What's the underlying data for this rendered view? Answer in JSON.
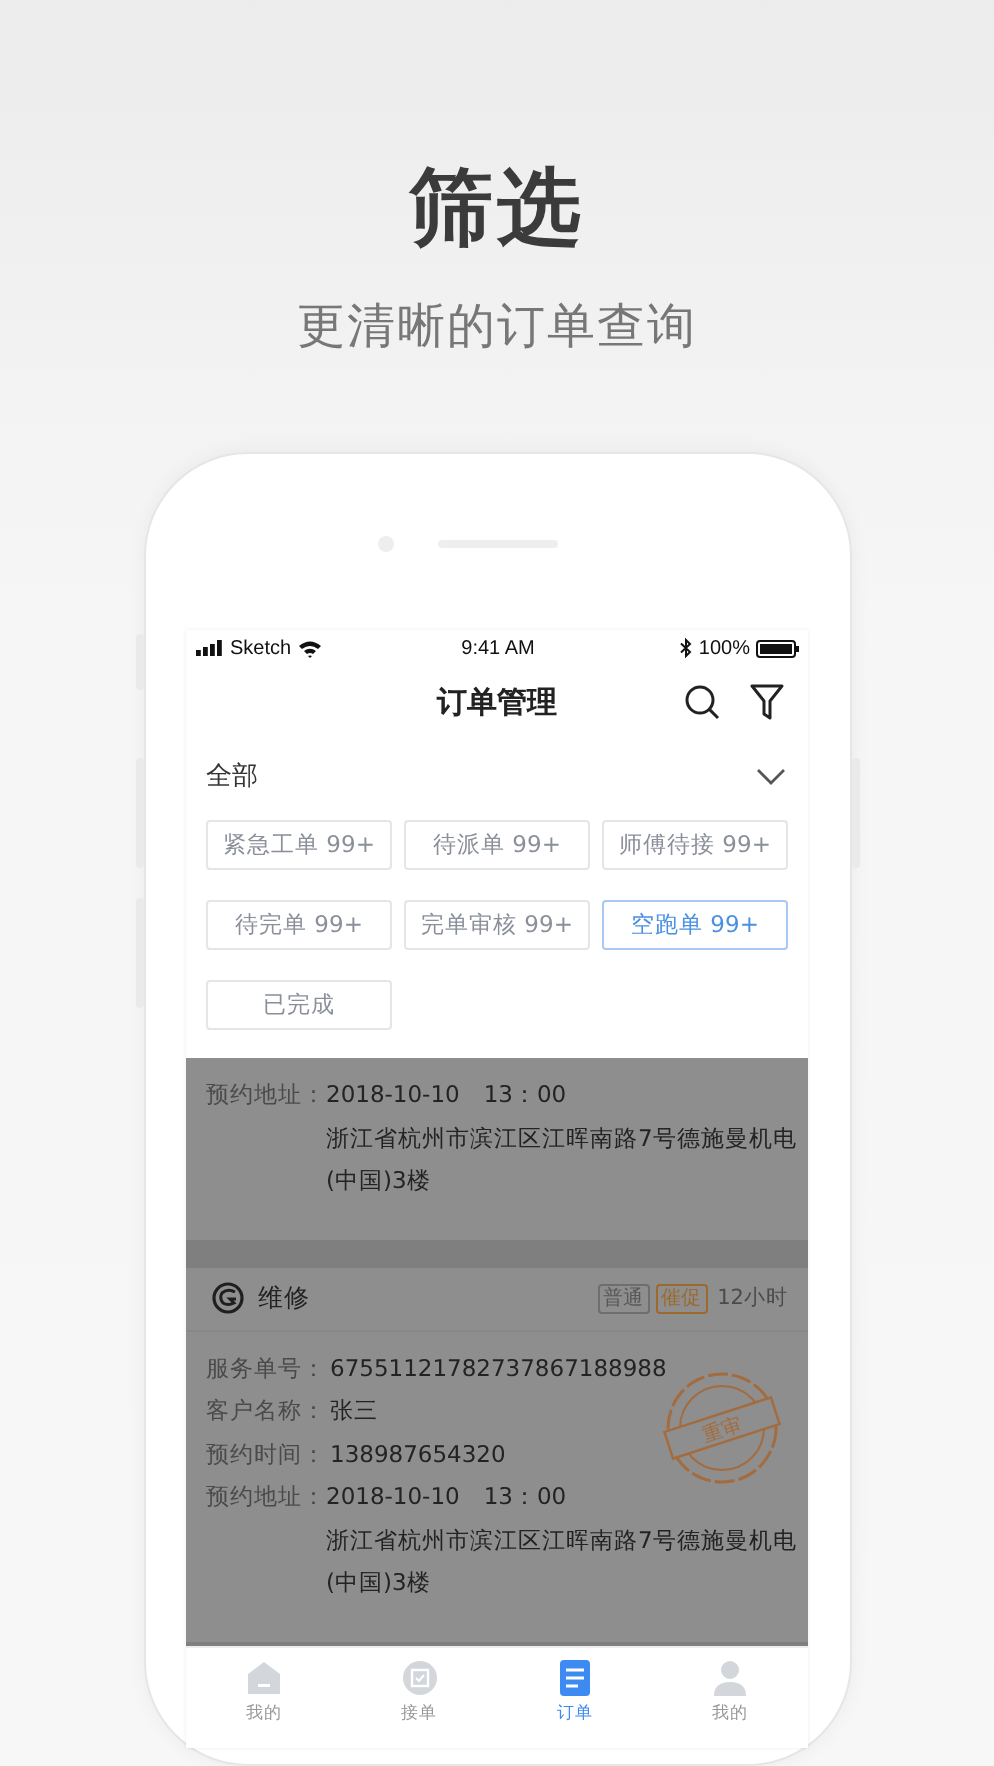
{
  "hero": {
    "title": "筛选",
    "subtitle": "更清晰的订单查询"
  },
  "status_bar": {
    "carrier": "Sketch",
    "time": "9:41 AM",
    "battery": "100%"
  },
  "nav": {
    "title": "订单管理"
  },
  "filter": {
    "label": "全部"
  },
  "chips": [
    {
      "label": "紧急工单 99+",
      "selected": false
    },
    {
      "label": "待派单 99+",
      "selected": false
    },
    {
      "label": "师傅待接 99+",
      "selected": false
    },
    {
      "label": "待完单 99+",
      "selected": false
    },
    {
      "label": "完单审核 99+",
      "selected": false
    },
    {
      "label": "空跑单 99+",
      "selected": true
    },
    {
      "label": "已完成",
      "selected": false
    }
  ],
  "orders": [
    {
      "fields": [
        {
          "label": "预约地址：",
          "values": [
            "2018-10-10　13：00",
            "浙江省杭州市滨江区江晖南路7号德施曼机电",
            "(中国)3楼"
          ]
        }
      ]
    },
    {
      "category": "维修",
      "tags": [
        {
          "label": "普通",
          "kind": "normal"
        },
        {
          "label": "催促",
          "kind": "urge"
        }
      ],
      "time": "12小时",
      "stamp": "重审",
      "fields": [
        {
          "label": "服务单号：",
          "values": [
            "67551121782737867188988"
          ]
        },
        {
          "label": "客户名称：",
          "values": [
            "张三"
          ]
        },
        {
          "label": "预约时间：",
          "values": [
            "138987654320"
          ]
        },
        {
          "label": "预约地址：",
          "values": [
            "2018-10-10　13：00",
            "浙江省杭州市滨江区江晖南路7号德施曼机电",
            "(中国)3楼"
          ]
        }
      ]
    }
  ],
  "tabs": [
    {
      "label": "我的",
      "kind": "home",
      "selected": false
    },
    {
      "label": "接单",
      "kind": "receive",
      "selected": false
    },
    {
      "label": "订单",
      "kind": "orders",
      "selected": true
    },
    {
      "label": "我的",
      "kind": "profile",
      "selected": false
    }
  ]
}
